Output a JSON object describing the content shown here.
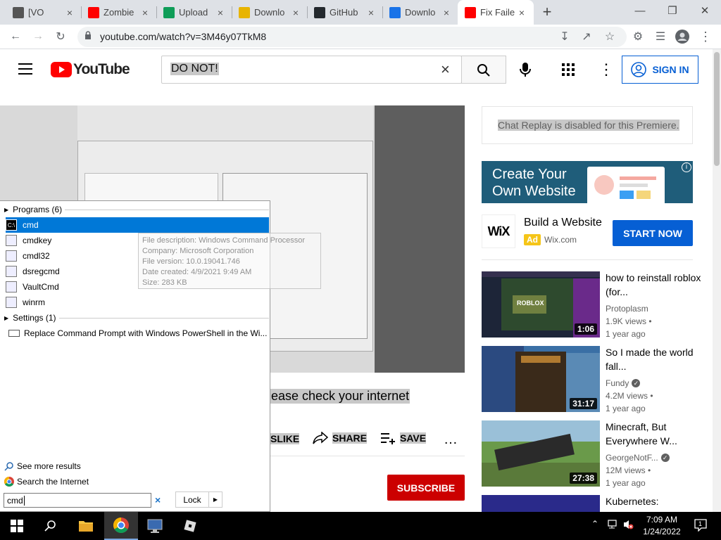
{
  "browser": {
    "tabs": [
      {
        "title": "[VO",
        "icon": "roblox-icon",
        "color": "#555"
      },
      {
        "title": "Zombie",
        "icon": "youtube-icon",
        "color": "#ff0000"
      },
      {
        "title": "Upload",
        "icon": "upload-icon",
        "color": "#0f9d58"
      },
      {
        "title": "Downlo",
        "icon": "download-icon",
        "color": "#e8b400"
      },
      {
        "title": "GitHub",
        "icon": "github-icon",
        "color": "#24292e"
      },
      {
        "title": "Downlo",
        "icon": "download-icon",
        "color": "#1a73e8"
      },
      {
        "title": "Fix Faile",
        "icon": "youtube-icon",
        "color": "#ff0000"
      }
    ],
    "url": "youtube.com/watch?v=3M46y07TkM8"
  },
  "youtube": {
    "logo_text": "YouTube",
    "search_value": "DO NOT!",
    "signin_label": "SIGN IN",
    "chat_replay": "Chat Replay is disabled for this Premiere.",
    "video_caption_partial": "ease check your internet",
    "actions": {
      "dislike": "SLIKE",
      "share": "SHARE",
      "save": "SAVE"
    },
    "subscribe_label": "SUBSCRIBE",
    "ad": {
      "banner_line1": "Create Your",
      "banner_line2": "Own Website",
      "logo": "WiX",
      "title": "Build a Website",
      "badge": "Ad",
      "domain": "Wix.com",
      "cta": "START NOW"
    },
    "recommendations": [
      {
        "title": "how to reinstall roblox (for...",
        "channel": "Protoplasm",
        "verified": false,
        "views": "1.9K views",
        "age": "1 year ago",
        "duration": "1:06"
      },
      {
        "title": "So I made the world fall...",
        "channel": "Fundy",
        "verified": true,
        "views": "4.2M views",
        "age": "1 year ago",
        "duration": "31:17"
      },
      {
        "title": "Minecraft, But Everywhere W...",
        "channel": "GeorgeNotF...",
        "verified": true,
        "views": "12M views",
        "age": "1 year ago",
        "duration": "27:38"
      },
      {
        "title": "Kubernetes:",
        "channel": "",
        "verified": false,
        "views": "",
        "age": "",
        "duration": ""
      }
    ]
  },
  "start_menu": {
    "programs_header": "Programs (6)",
    "programs": [
      "cmd",
      "cmdkey",
      "cmdl32",
      "dsregcmd",
      "VaultCmd",
      "winrm"
    ],
    "settings_header": "Settings (1)",
    "settings_item": "Replace Command Prompt with Windows PowerShell in the Wi...",
    "tooltip": {
      "description": "File description: Windows Command Processor",
      "company": "Company: Microsoft Corporation",
      "version": "File version: 10.0.19041.746",
      "created": "Date created: 4/9/2021 9:49 AM",
      "size": "Size: 283 KB"
    },
    "see_more": "See more results",
    "search_internet": "Search the Internet",
    "search_value": "cmd",
    "lock_label": "Lock"
  },
  "taskbar": {
    "time": "7:09 AM",
    "date": "1/24/2022",
    "notification_count": "1"
  }
}
